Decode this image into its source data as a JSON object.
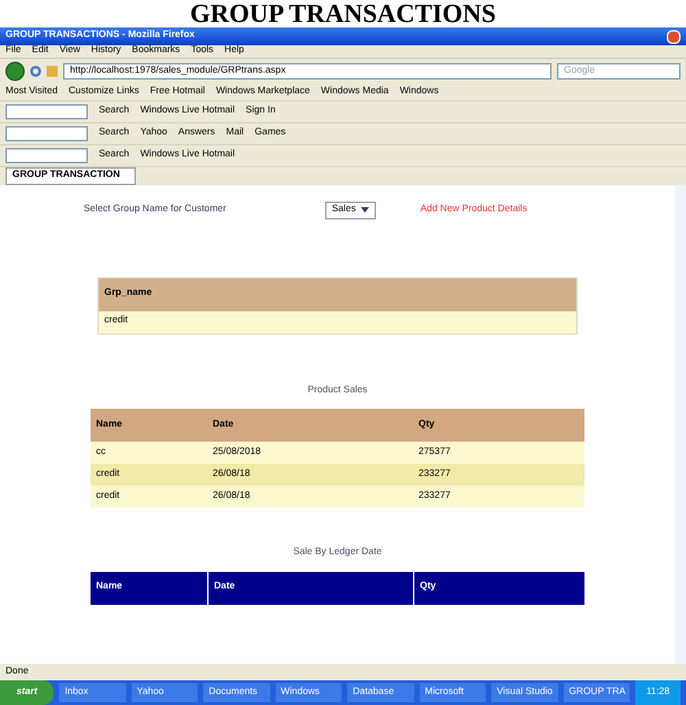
{
  "heading": "GROUP TRANSACTIONS",
  "window": {
    "title": "GROUP TRANSACTIONS - Mozilla Firefox"
  },
  "menu": [
    "File",
    "Edit",
    "View",
    "History",
    "Bookmarks",
    "Tools",
    "Help"
  ],
  "address": {
    "value": "http://localhost:1978/sales_module/GRPtrans.aspx"
  },
  "search": {
    "placeholder": "Google"
  },
  "bookmarks": [
    "Most Visited",
    "Customize Links",
    "Free Hotmail",
    "Windows Marketplace",
    "Windows Media",
    "Windows"
  ],
  "toolbar_1": [
    "Search",
    "Windows Live Hotmail",
    "Sign In"
  ],
  "toolbar_2": [
    "Search",
    "Yahoo",
    "Answers",
    "Mail",
    "Games"
  ],
  "toolbar_3": [
    "Search",
    "Windows Live Hotmail"
  ],
  "tab": {
    "title": "GROUP TRANSACTION"
  },
  "form": {
    "label": "Select Group Name for Customer",
    "select": "Sales",
    "link": "Add New Product Details"
  },
  "group_table": {
    "columns": [
      "Grp_name"
    ],
    "rows": [
      [
        "credit"
      ]
    ]
  },
  "product_table": {
    "title": "Product Sales",
    "columns": [
      "Name",
      "Date",
      "Qty"
    ],
    "rows": [
      [
        "cc",
        "25/08/2018",
        "275377"
      ],
      [
        "credit",
        "26/08/18",
        "233277"
      ],
      [
        "credit",
        "26/08/18",
        "233277"
      ]
    ]
  },
  "ledger_table": {
    "title": "Sale By Ledger Date",
    "columns": [
      "Name",
      "Date",
      "Qty"
    ]
  },
  "status_bar": "Done",
  "taskbar": {
    "start": "start",
    "items": [
      "Inbox",
      "Yahoo",
      "Documents",
      "Windows",
      "Database",
      "Microsoft",
      "Visual Studio",
      "GROUP TRA"
    ],
    "time": "11:28"
  }
}
